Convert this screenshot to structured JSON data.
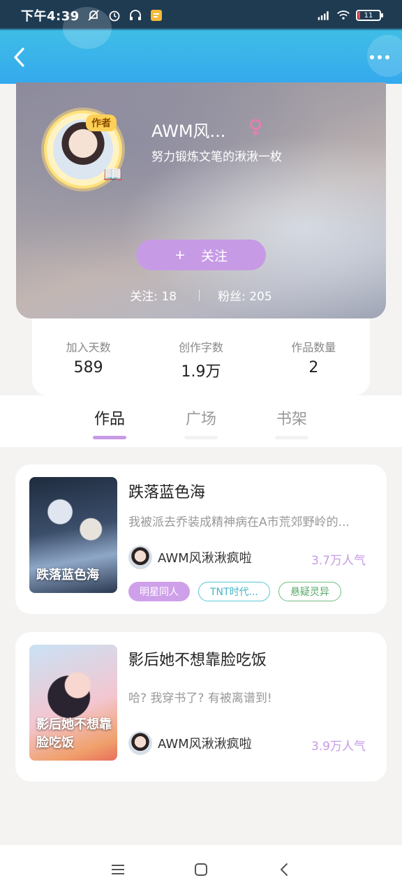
{
  "status_bar": {
    "time": "下午4:39",
    "battery": "11"
  },
  "profile": {
    "author_tag": "作者",
    "name": "AWM风...",
    "bio": "努力锻炼文笔的湫湫一枚",
    "follow_button": "关注",
    "following_label": "关注: 18",
    "fans_label": "粉丝: 205"
  },
  "stats": [
    {
      "label": "加入天数",
      "value": "589"
    },
    {
      "label": "创作字数",
      "value": "1.9万"
    },
    {
      "label": "作品数量",
      "value": "2"
    }
  ],
  "tabs": [
    {
      "label": "作品",
      "active": true
    },
    {
      "label": "广场",
      "active": false
    },
    {
      "label": "书架",
      "active": false
    }
  ],
  "works": [
    {
      "title": "跌落蓝色海",
      "description": "我被派去乔装成精神病在A市荒郊野岭的...",
      "cover_text": "跌落蓝色海",
      "author": "AWM风湫湫疯啦",
      "popularity": "3.7万人气",
      "tags": [
        "明星同人",
        "TNT时代...",
        "悬疑灵异"
      ]
    },
    {
      "title": "影后她不想靠脸吃饭",
      "description": "哈? 我穿书了? 有被离谱到!",
      "cover_text": "影后她不想靠脸吃饭",
      "author": "AWM风湫湫疯啦",
      "popularity": "3.9万人气",
      "tags": []
    }
  ],
  "colors": {
    "accent": "#c79ae6",
    "header": "#34a9ee",
    "gender": "#f07ab0"
  }
}
